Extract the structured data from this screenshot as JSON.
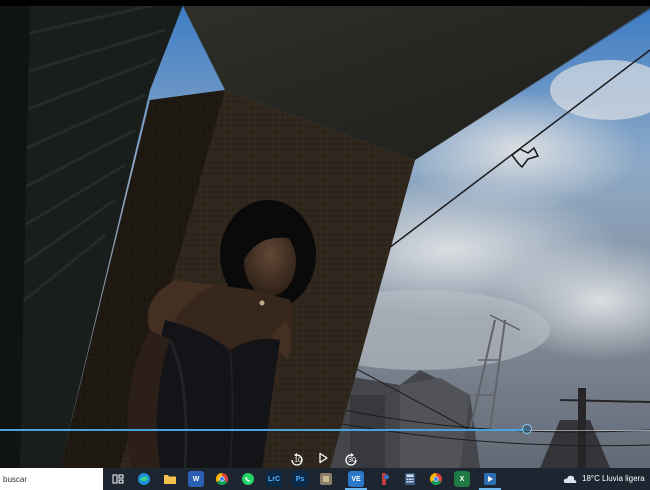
{
  "player": {
    "progress_fraction": 0.81,
    "controls": {
      "rewind_label": "10",
      "forward_label": "30"
    }
  },
  "taskbar": {
    "search_placeholder": "buscar",
    "apps": [
      {
        "name": "task-view",
        "icon": "task-view-icon"
      },
      {
        "name": "edge",
        "icon": "edge-icon",
        "color": "#1e8fd6"
      },
      {
        "name": "file-explorer",
        "icon": "folder-icon",
        "color": "#f2c14e"
      },
      {
        "name": "word",
        "icon": "word-icon",
        "label": "W",
        "color": "#2b5fb4"
      },
      {
        "name": "chrome",
        "icon": "chrome-icon"
      },
      {
        "name": "whatsapp",
        "icon": "whatsapp-icon",
        "color": "#25d366"
      },
      {
        "name": "lightroom-classic",
        "icon": "lightroom-icon",
        "label": "LrC",
        "color": "#0a2a45"
      },
      {
        "name": "photoshop",
        "icon": "photoshop-icon",
        "label": "Ps",
        "color": "#0b2a4a"
      },
      {
        "name": "app-generic",
        "icon": "app-icon",
        "color": "#8a7f6a"
      },
      {
        "name": "vscode-active",
        "icon": "vs-icon",
        "label": "VE",
        "color": "#2a78c8"
      },
      {
        "name": "app-red",
        "icon": "app-red-icon",
        "color": "#c23a3a"
      },
      {
        "name": "calculator",
        "icon": "calculator-icon",
        "color": "#3d5a80"
      },
      {
        "name": "chrome-2",
        "icon": "chrome-icon"
      },
      {
        "name": "excel",
        "icon": "excel-icon",
        "label": "X",
        "color": "#1f7a44"
      },
      {
        "name": "media-player",
        "icon": "media-player-icon",
        "color": "#2d6fb0"
      }
    ],
    "weather": {
      "icon": "cloud-icon",
      "temperature": "18°C",
      "description": "Lluvia ligera"
    }
  }
}
